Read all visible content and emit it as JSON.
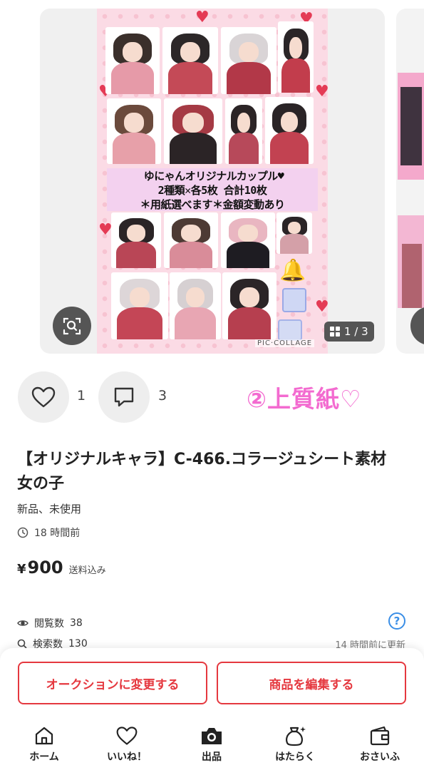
{
  "gallery": {
    "counter": "1 / 3",
    "image_caption": {
      "line1": "ゆにゃんオリジナルカップル♥",
      "line2": "2種類✕各5枚 合計10枚",
      "line3": "＊用紙選べます＊金額変動あり"
    },
    "watermark": "PIC·COLLAGE"
  },
  "actions": {
    "like_count": "1",
    "comment_count": "3",
    "annotation": "②上質紙♡"
  },
  "product": {
    "title": "【オリジナルキャラ】C-466.コラージュシート素材　女の子",
    "condition": "新品、未使用",
    "posted": "18 時間前",
    "price_symbol": "¥",
    "price": "900",
    "shipping": "送料込み"
  },
  "stats": {
    "views_label": "閲覧数",
    "views": "38",
    "search_label": "検索数",
    "search": "130",
    "updated": "14 時間前に更新"
  },
  "buttons": {
    "auction": "オークションに変更する",
    "edit": "商品を編集する"
  },
  "tabbar": {
    "home": "ホーム",
    "likes": "いいね！",
    "sell": "出品",
    "work": "はたらく",
    "wallet": "おさいふ"
  },
  "colors": {
    "accent": "#e5383f",
    "annotation": "#f36bd0",
    "help": "#3a8ee6"
  }
}
